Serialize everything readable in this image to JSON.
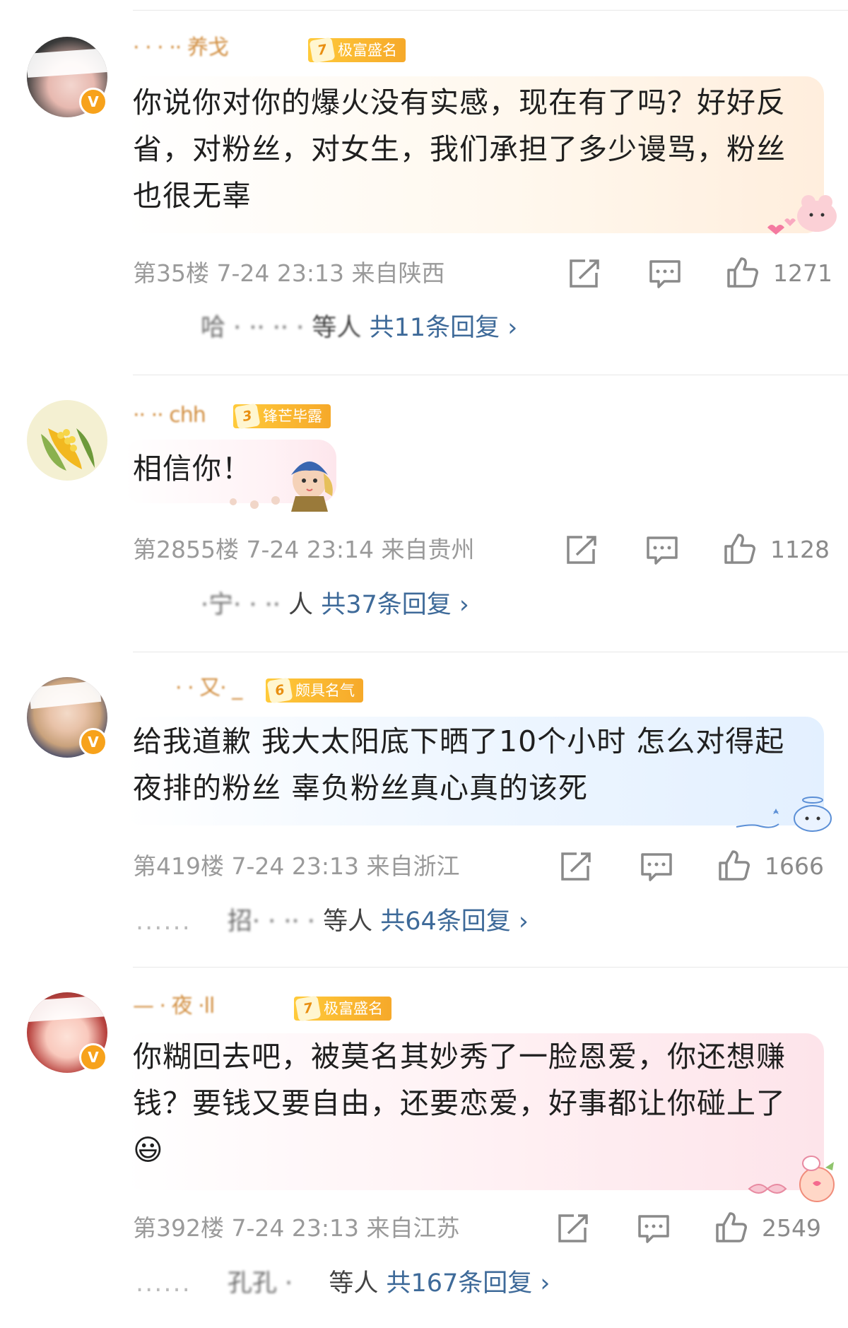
{
  "comments": [
    {
      "user_name": "· ·  · ·· 养戈",
      "level_num": "7",
      "level_label": "极富盛名",
      "text": "你说你对你的爆火没有实感，现在有了吗？好好反省，对粉丝，对女生，我们承担了多少谩骂，粉丝也很无辜",
      "floor": "第35楼",
      "time": "7-24 23:13",
      "location": "来自陕西",
      "likes": "1271",
      "reply_prefix": "",
      "reply_names": "哈 ·  ·· ··  ·",
      "reply_suffix": "等人",
      "reply_link": "共11条回复",
      "verified": "V"
    },
    {
      "user_name": "·· ·· chh",
      "level_num": "3",
      "level_label": "锋芒毕露",
      "text": "相信你！",
      "floor": "第2855楼",
      "time": "7-24 23:14",
      "location": "来自贵州",
      "likes": "1128",
      "reply_prefix": "",
      "reply_names": "·宁· ·    ··",
      "reply_suffix": "人",
      "reply_link": "共37条回复",
      "verified": ""
    },
    {
      "user_name": "· · 又· _",
      "level_num": "6",
      "level_label": "颇具名气",
      "text": "给我道歉 我大太阳底下晒了10个小时 怎么对得起夜排的粉丝  辜负粉丝真心真的该死",
      "floor": "第419楼",
      "time": "7-24 23:13",
      "location": "来自浙江",
      "likes": "1666",
      "reply_prefix": "......",
      "reply_names": "招·  · ··  ·",
      "reply_suffix": "等人",
      "reply_link": "共64条回复",
      "verified": "V"
    },
    {
      "user_name": "— · 夜 ·ll",
      "level_num": "7",
      "level_label": "极富盛名",
      "text": "你糊回去吧，被莫名其妙秀了一脸恩爱，你还想赚钱？要钱又要自由，还要恋爱，好事都让你碰上了😃",
      "floor": "第392楼",
      "time": "7-24 23:13",
      "location": "来自江苏",
      "likes": "2549",
      "reply_prefix": "......",
      "reply_names": "孔孔 ·",
      "reply_suffix": "等人",
      "reply_link": "共167条回复",
      "verified": "V"
    }
  ],
  "icons": {
    "share": "share-icon",
    "comment": "comment-icon",
    "like": "like-icon",
    "chevron": "chevron-right-icon"
  },
  "colors": {
    "link": "#3e6a99",
    "meta": "#9a9a9a",
    "level_badge": "#f6a92a",
    "verified_badge": "#f7a21b"
  }
}
